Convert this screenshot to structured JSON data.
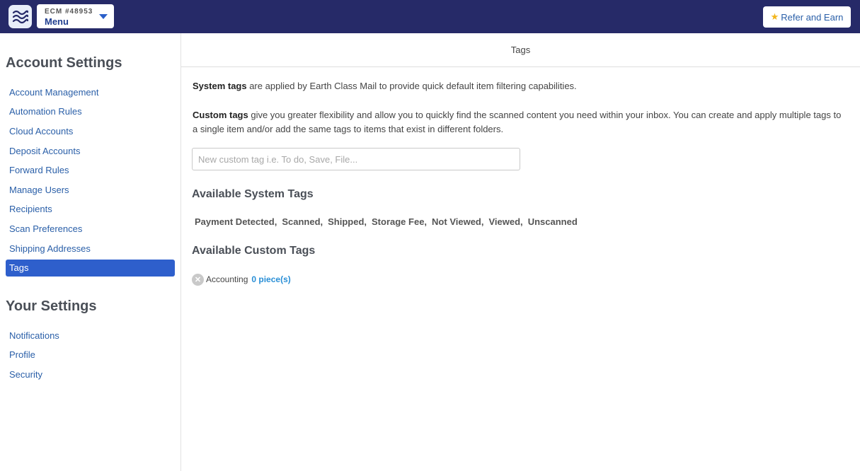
{
  "header": {
    "account_id": "ECM #48953",
    "menu_label": "Menu",
    "refer_label": "Refer and Earn"
  },
  "sidebar": {
    "account_heading": "Account Settings",
    "account_items": [
      {
        "label": "Account Management"
      },
      {
        "label": "Automation Rules"
      },
      {
        "label": "Cloud Accounts"
      },
      {
        "label": "Deposit Accounts"
      },
      {
        "label": "Forward Rules"
      },
      {
        "label": "Manage Users"
      },
      {
        "label": "Recipients"
      },
      {
        "label": "Scan Preferences"
      },
      {
        "label": "Shipping Addresses"
      },
      {
        "label": "Tags"
      }
    ],
    "active_item": "Tags",
    "your_heading": "Your Settings",
    "your_items": [
      {
        "label": "Notifications"
      },
      {
        "label": "Profile"
      },
      {
        "label": "Security"
      }
    ]
  },
  "main": {
    "title": "Tags",
    "system_intro_bold": "System tags",
    "system_intro_text": " are applied by Earth Class Mail to provide quick default item filtering capabilities.",
    "custom_intro_bold": "Custom tags",
    "custom_intro_text": " give you greater flexibility and allow you to quickly find the scanned content you need within your inbox. You can create and apply multiple tags to a single item and/or add the same tags to items that exist in different folders.",
    "tag_input": {
      "placeholder": "New custom tag i.e. To do, Save, File...",
      "value": ""
    },
    "system_tags_heading": "Available System Tags",
    "system_tags": [
      "Payment Detected,",
      "Scanned,",
      "Shipped,",
      "Storage Fee,",
      "Not Viewed,",
      "Viewed,",
      "Unscanned"
    ],
    "custom_tags_heading": "Available Custom Tags",
    "custom_tags": [
      {
        "name": "Accounting",
        "count_label": "0 piece(s)"
      }
    ]
  },
  "colors": {
    "topbar": "#262a68",
    "active_nav": "#2e5fcc",
    "link": "#2a5fa8",
    "star": "#f2b51c"
  }
}
